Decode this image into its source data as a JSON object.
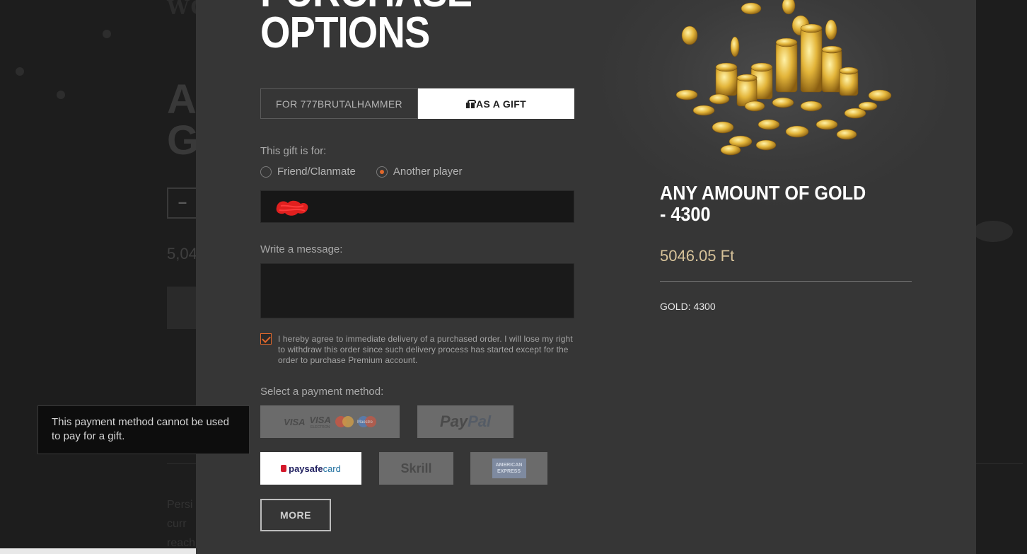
{
  "modal": {
    "title_line1": "PURCHASE",
    "title_line2": "OPTIONS",
    "tabs": [
      {
        "label": "FOR 777BRUTALHAMMER",
        "active": false
      },
      {
        "label": "AS A GIFT",
        "active": true,
        "icon": "gift-icon"
      }
    ],
    "gift_for_label": "This gift is for:",
    "recipient_options": [
      {
        "label": "Friend/Clanmate",
        "selected": false
      },
      {
        "label": "Another player",
        "selected": true
      }
    ],
    "recipient_input_value": "",
    "message_label": "Write a message:",
    "message_value": "",
    "agree_checked": true,
    "agree_text": "I hereby agree to immediate delivery of a purchased order. I will lose my right to withdraw this order since such delivery process has started except for the order to purchase Premium account.",
    "payment_label": "Select a payment method:",
    "payment_methods": {
      "cards": {
        "visa1": "VISA",
        "visa2": "VISA",
        "visa2_sub": "ELECTRON",
        "maestro": "Maestro",
        "enabled": false
      },
      "paypal": {
        "pay": "Pay",
        "pal": "Pal",
        "enabled": false
      },
      "paysafecard": {
        "pay": "pay",
        "safe": "safe",
        "card": "card",
        "enabled": true
      },
      "skrill": {
        "label": "Skrill",
        "enabled": false
      },
      "amex": {
        "line1": "AMERICAN",
        "line2": "EXPRESS",
        "enabled": false
      }
    },
    "more_label": "MORE"
  },
  "product": {
    "title": "ANY AMOUNT OF GOLD - 4300",
    "price": "5046.05 Ft",
    "detail": "GOLD: 4300"
  },
  "tooltip": {
    "text": "This payment method cannot be used to pay for a gift."
  },
  "colors": {
    "accent": "#e0672b",
    "price": "#d7c39a",
    "modal_bg": "#363636"
  }
}
